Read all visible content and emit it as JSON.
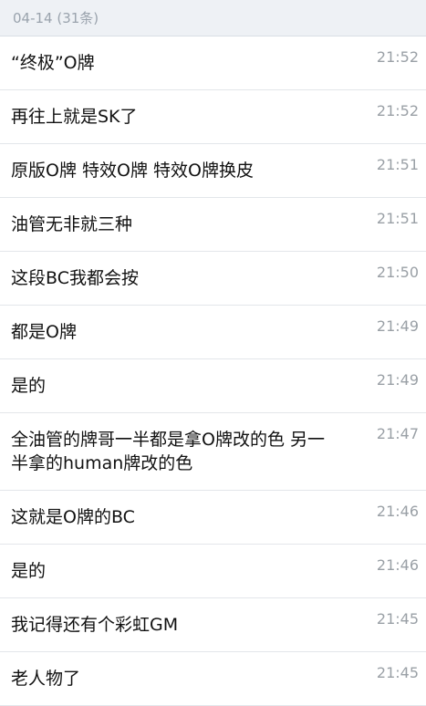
{
  "header": {
    "date_label": "04-14 (31条)"
  },
  "messages": [
    {
      "text": "“终极”O牌",
      "time": "21:52"
    },
    {
      "text": "再往上就是SK了",
      "time": "21:52"
    },
    {
      "text": "原版O牌 特效O牌 特效O牌换皮",
      "time": "21:51"
    },
    {
      "text": "油管无非就三种",
      "time": "21:51"
    },
    {
      "text": "这段BC我都会按",
      "time": "21:50"
    },
    {
      "text": "都是O牌",
      "time": "21:49"
    },
    {
      "text": "是的",
      "time": "21:49"
    },
    {
      "text": "全油管的牌哥一半都是拿O牌改的色 另一半拿的human牌改的色",
      "time": "21:47"
    },
    {
      "text": "这就是O牌的BC",
      "time": "21:46"
    },
    {
      "text": "是的",
      "time": "21:46"
    },
    {
      "text": "我记得还有个彩虹GM",
      "time": "21:45"
    },
    {
      "text": "老人物了",
      "time": "21:45"
    }
  ]
}
